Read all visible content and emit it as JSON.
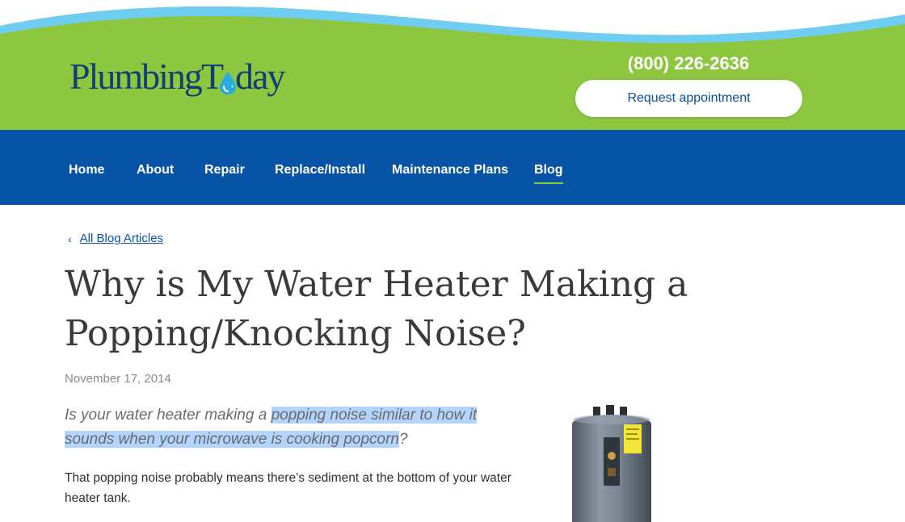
{
  "brand": {
    "logo_part1": "Plumbing",
    "logo_part2": "T",
    "logo_part3": "day",
    "primary_green": "#8dc63f",
    "primary_blue": "#0754a6",
    "wave_blue": "#6fcdf2"
  },
  "header": {
    "phone": "(800) 226-2636",
    "cta_label": "Request appointment"
  },
  "nav": {
    "items": [
      {
        "label": "Home"
      },
      {
        "label": "About"
      },
      {
        "label": "Repair"
      },
      {
        "label": "Replace/Install"
      },
      {
        "label": "Maintenance Plans"
      },
      {
        "label": "Blog",
        "active": true
      }
    ]
  },
  "breadcrumb": {
    "chevron": "‹",
    "label": "All Blog Articles"
  },
  "article": {
    "title": "Why is My Water Heater Making a Popping/Knocking Noise?",
    "date": "November 17, 2014",
    "lede_plain": "Is your water heater making a ",
    "lede_highlighted": "popping noise similar to how it sounds when your microwave is cooking popcorn",
    "lede_end": "?",
    "body": "That popping noise probably means there’s sediment at the bottom of your water heater tank."
  }
}
